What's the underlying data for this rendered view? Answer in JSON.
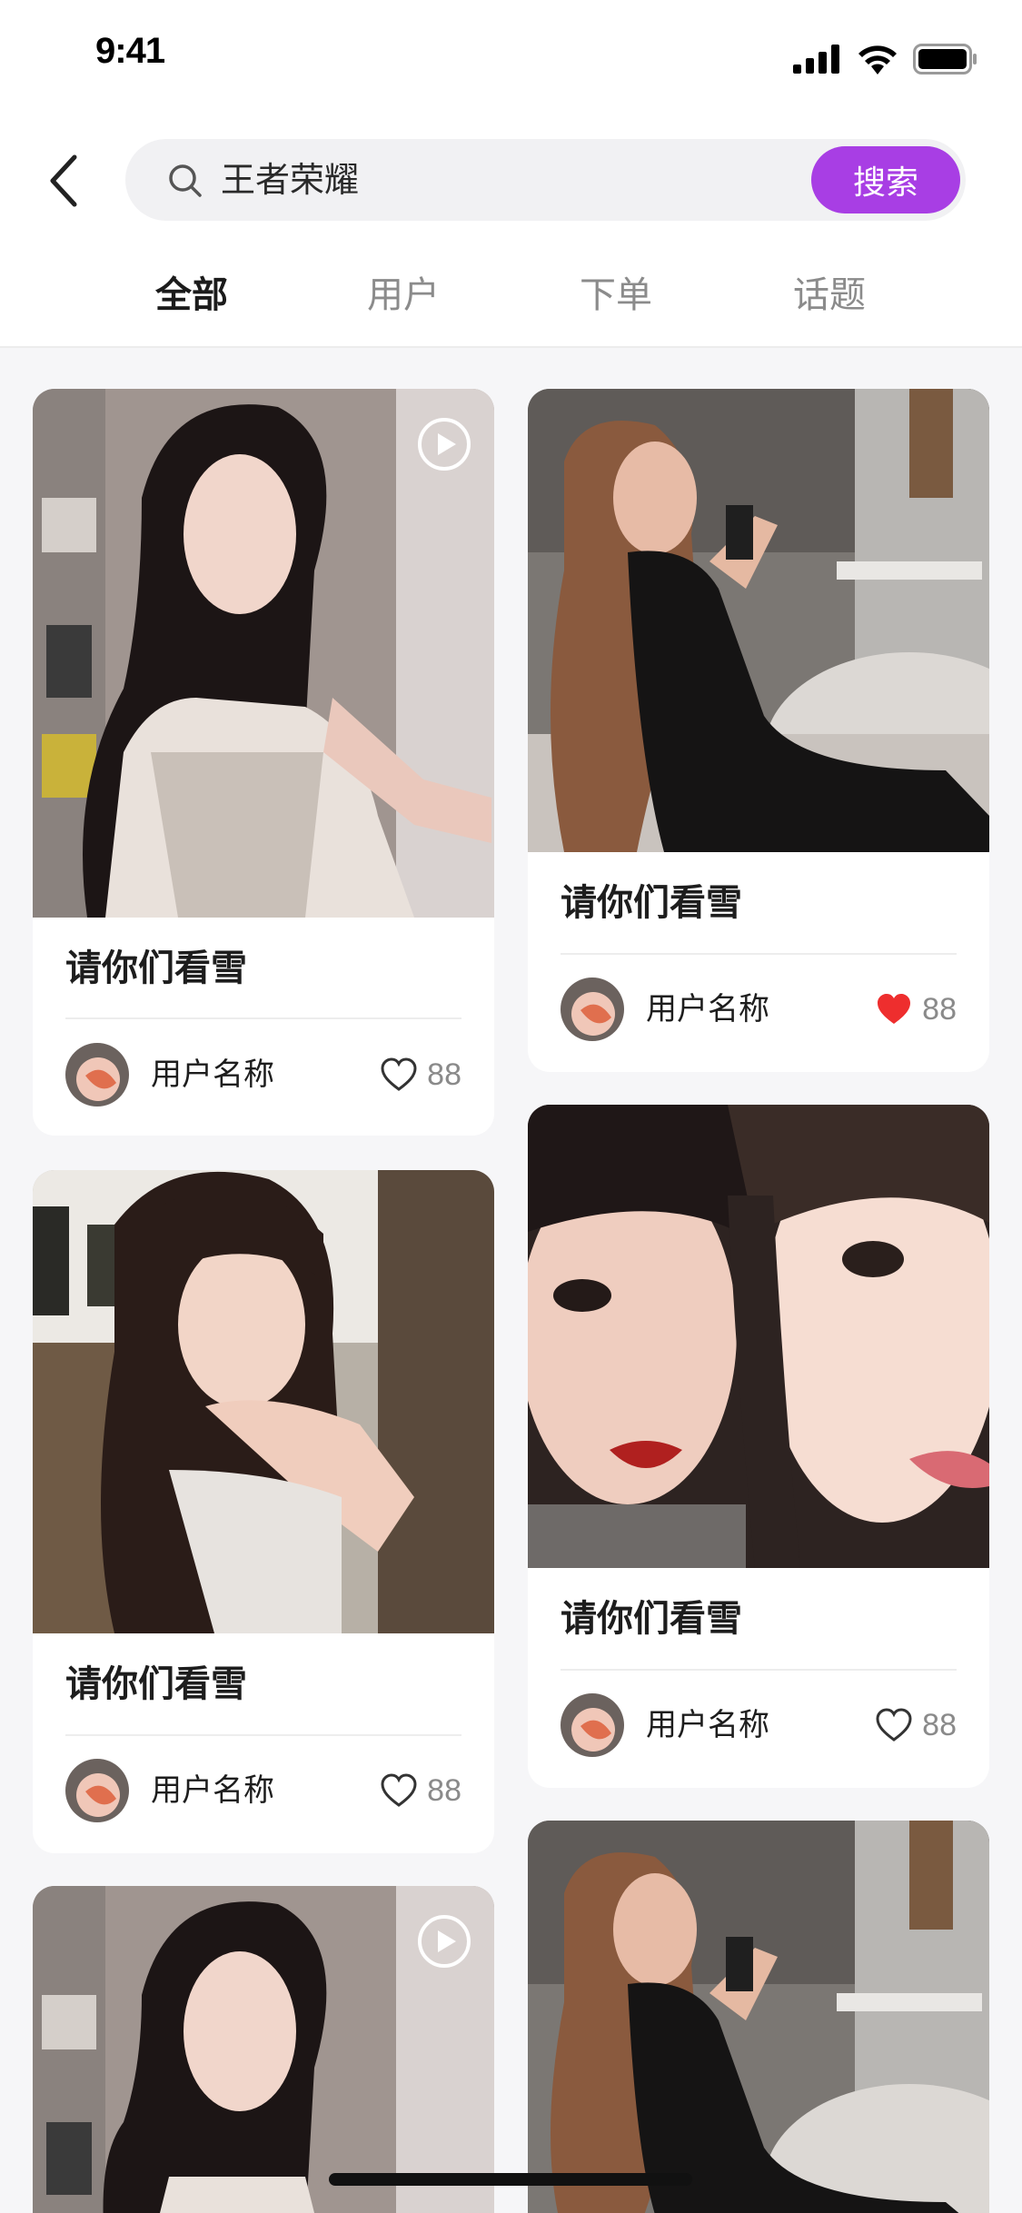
{
  "status": {
    "time": "9:41"
  },
  "search": {
    "value": "王者荣耀",
    "button_label": "搜索"
  },
  "tabs": [
    {
      "label": "全部",
      "active": true
    },
    {
      "label": "用户",
      "active": false
    },
    {
      "label": "下单",
      "active": false
    },
    {
      "label": "话题",
      "active": false
    }
  ],
  "colors": {
    "accent": "#a83ee4",
    "liked": "#ee2e2e"
  },
  "cards": [
    {
      "title": "请你们看雪",
      "user": "用户名称",
      "likes": "88",
      "liked": false,
      "has_video": true
    },
    {
      "title": "请你们看雪",
      "user": "用户名称",
      "likes": "88",
      "liked": true,
      "has_video": false
    },
    {
      "title": "请你们看雪",
      "user": "用户名称",
      "likes": "88",
      "liked": false,
      "has_video": false
    },
    {
      "title": "请你们看雪",
      "user": "用户名称",
      "likes": "88",
      "liked": false,
      "has_video": false
    },
    {
      "title": "",
      "user": "",
      "likes": "",
      "liked": false,
      "has_video": true
    },
    {
      "title": "",
      "user": "",
      "likes": "",
      "liked": false,
      "has_video": false
    }
  ]
}
